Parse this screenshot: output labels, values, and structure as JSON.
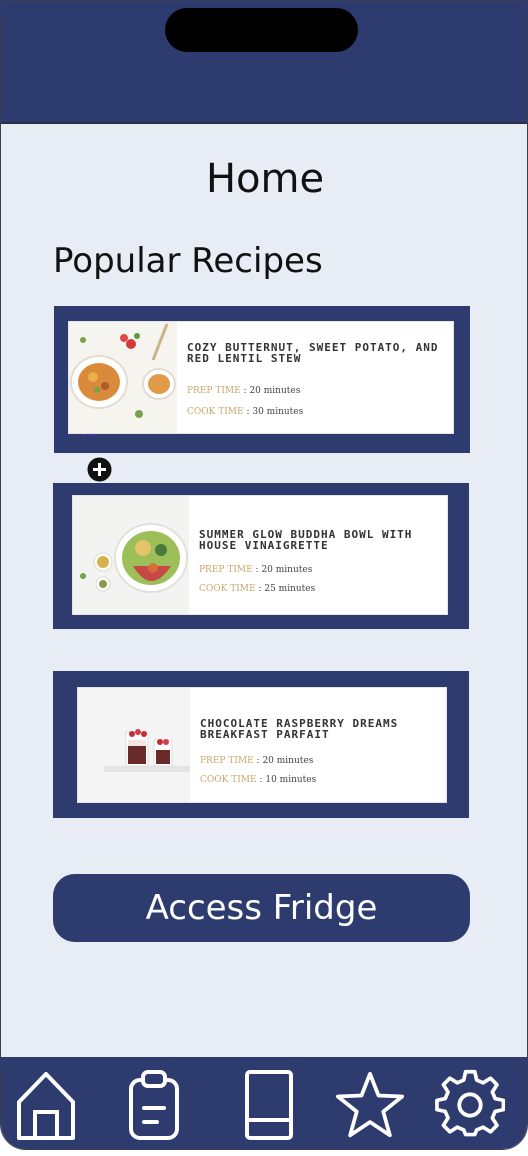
{
  "page": {
    "title": "Home",
    "section_title": "Popular Recipes"
  },
  "recipes": [
    {
      "name": "COZY BUTTERNUT, SWEET POTATO, AND RED LENTIL STEW",
      "prep_label": "PREP TIME",
      "prep_value": ": 20 minutes",
      "cook_label": "COOK TIME",
      "cook_value": ": 30 minutes"
    },
    {
      "name": "SUMMER GLOW BUDDHA BOWL WITH HOUSE VINAIGRETTE",
      "prep_label": "PREP TIME",
      "prep_value": ": 20 minutes",
      "cook_label": "COOK TIME",
      "cook_value": ": 25 minutes"
    },
    {
      "name": "CHOCOLATE RASPBERRY DREAMS BREAKFAST PARFAIT",
      "prep_label": "PREP TIME",
      "prep_value": ": 20 minutes",
      "cook_label": "COOK TIME",
      "cook_value": ": 10 minutes"
    }
  ],
  "card_overlay": {
    "dots": "...",
    "add_icon": "plus-circle-icon"
  },
  "actions": {
    "access_fridge": "Access Fridge"
  },
  "tab_bar": {
    "items": [
      {
        "icon": "home-icon"
      },
      {
        "icon": "clipboard-icon"
      },
      {
        "icon": "book-icon"
      },
      {
        "icon": "star-icon"
      },
      {
        "icon": "gear-icon"
      }
    ]
  },
  "colors": {
    "primary": "#2d3b6e",
    "background": "#e8ecf5",
    "accent_gold": "#c9a86b"
  }
}
